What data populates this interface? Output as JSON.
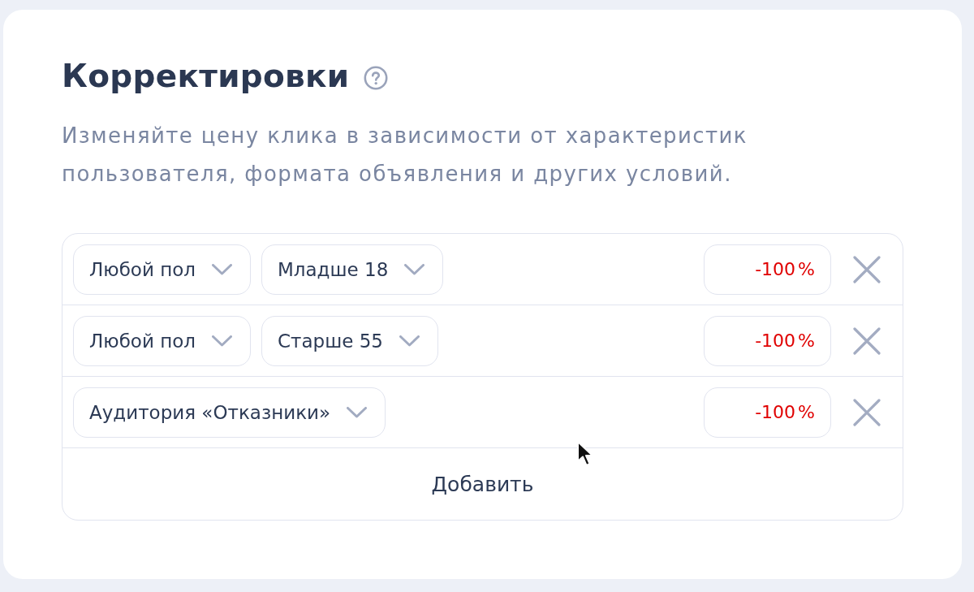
{
  "panel": {
    "title": "Корректировки",
    "description": "Изменяйте цену клика в зависимости от характеристик пользователя, формата объявления и других условий."
  },
  "adjustments": [
    {
      "conditions": [
        {
          "label": "Любой пол"
        },
        {
          "label": "Младше 18"
        }
      ],
      "value": "-100",
      "unit": "%"
    },
    {
      "conditions": [
        {
          "label": "Любой пол"
        },
        {
          "label": "Старше 55"
        }
      ],
      "value": "-100",
      "unit": "%"
    },
    {
      "conditions": [
        {
          "label": "Аудитория «Отказники»"
        }
      ],
      "value": "-100",
      "unit": "%"
    }
  ],
  "add_button": {
    "label": "Добавить"
  }
}
